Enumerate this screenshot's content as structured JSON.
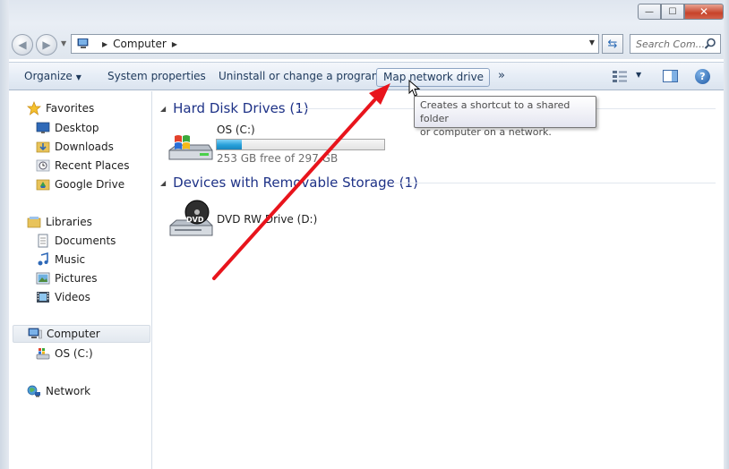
{
  "address": {
    "location": "Computer"
  },
  "search": {
    "placeholder": "Search Com..."
  },
  "toolbar": {
    "organize": "Organize",
    "system_properties": "System properties",
    "uninstall": "Uninstall or change a program",
    "map_network_drive": "Map network drive",
    "more": "»"
  },
  "tooltip": {
    "line1": "Creates a shortcut to a shared folder",
    "line2": "or computer on a network."
  },
  "sidebar": {
    "favorites": {
      "label": "Favorites",
      "items": [
        {
          "label": "Desktop"
        },
        {
          "label": "Downloads"
        },
        {
          "label": "Recent Places"
        },
        {
          "label": "Google Drive"
        }
      ]
    },
    "libraries": {
      "label": "Libraries",
      "items": [
        {
          "label": "Documents"
        },
        {
          "label": "Music"
        },
        {
          "label": "Pictures"
        },
        {
          "label": "Videos"
        }
      ]
    },
    "computer": {
      "label": "Computer",
      "items": [
        {
          "label": "OS (C:)"
        }
      ]
    },
    "network": {
      "label": "Network"
    }
  },
  "content": {
    "hdd_group": "Hard Disk Drives (1)",
    "removable_group": "Devices with Removable Storage (1)",
    "drives": [
      {
        "name": "OS (C:)",
        "free_text": "253 GB free of 297 GB",
        "used_fraction": 0.148
      },
      {
        "name": "DVD RW Drive (D:)",
        "icon_label": "DVD"
      }
    ]
  },
  "colors": {
    "annotation_arrow": "#e8141c",
    "group_header": "#1e3287"
  }
}
